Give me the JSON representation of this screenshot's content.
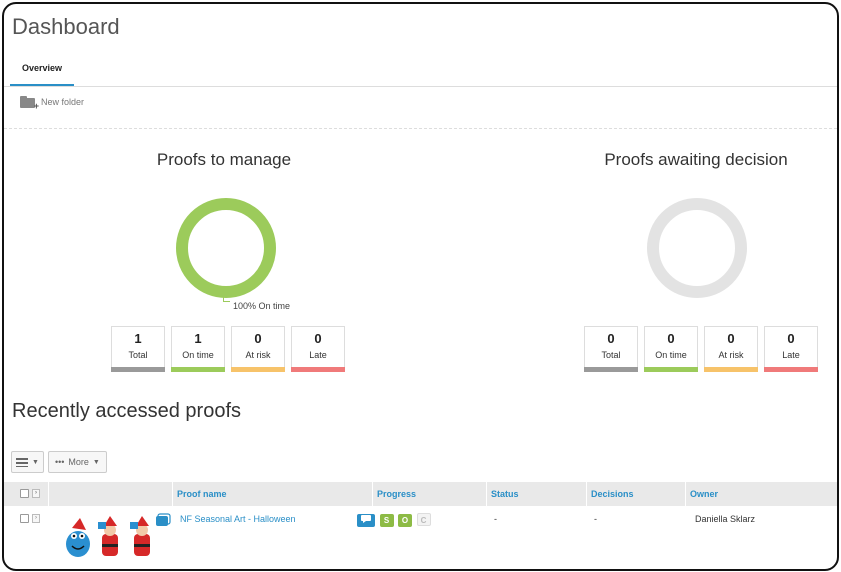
{
  "header": {
    "title": "Dashboard"
  },
  "tabs": [
    {
      "label": "Overview",
      "active": true
    }
  ],
  "toolbar_top": {
    "new_folder_label": "New folder",
    "icon": "folder-plus-icon"
  },
  "panels": [
    {
      "title": "Proofs to manage",
      "donut": {
        "on_time_fraction": 1.0,
        "color": "#9ccb5b",
        "label": "100% On time"
      },
      "stats": [
        {
          "value": "1",
          "label": "Total",
          "color": "#9a9a9a"
        },
        {
          "value": "1",
          "label": "On time",
          "color": "#9ccb5b"
        },
        {
          "value": "0",
          "label": "At risk",
          "color": "#f7c36a"
        },
        {
          "value": "0",
          "label": "Late",
          "color": "#f07a7a"
        }
      ]
    },
    {
      "title": "Proofs awaiting decision",
      "donut": {
        "on_time_fraction": 0,
        "color": "#e3e3e3",
        "label": ""
      },
      "stats": [
        {
          "value": "0",
          "label": "Total",
          "color": "#9a9a9a"
        },
        {
          "value": "0",
          "label": "On time",
          "color": "#9ccb5b"
        },
        {
          "value": "0",
          "label": "At risk",
          "color": "#f7c36a"
        },
        {
          "value": "0",
          "label": "Late",
          "color": "#f07a7a"
        }
      ]
    }
  ],
  "recent": {
    "title": "Recently accessed proofs",
    "more_label": "More",
    "columns": [
      "Proof name",
      "Progress",
      "Status",
      "Decisions",
      "Owner"
    ],
    "rows": [
      {
        "proof_name": "NF Seasonal Art - Halloween",
        "progress_badges": [
          {
            "text": "",
            "icon": "comment-icon",
            "color": "#2a8fc7"
          },
          {
            "text": "S",
            "color": "#8dbb45"
          },
          {
            "text": "O",
            "color": "#8dbb45"
          },
          {
            "text": "C",
            "color": "#e6e6e6"
          }
        ],
        "status": "-",
        "decisions": "-",
        "owner": "Daniella Sklarz"
      }
    ]
  }
}
